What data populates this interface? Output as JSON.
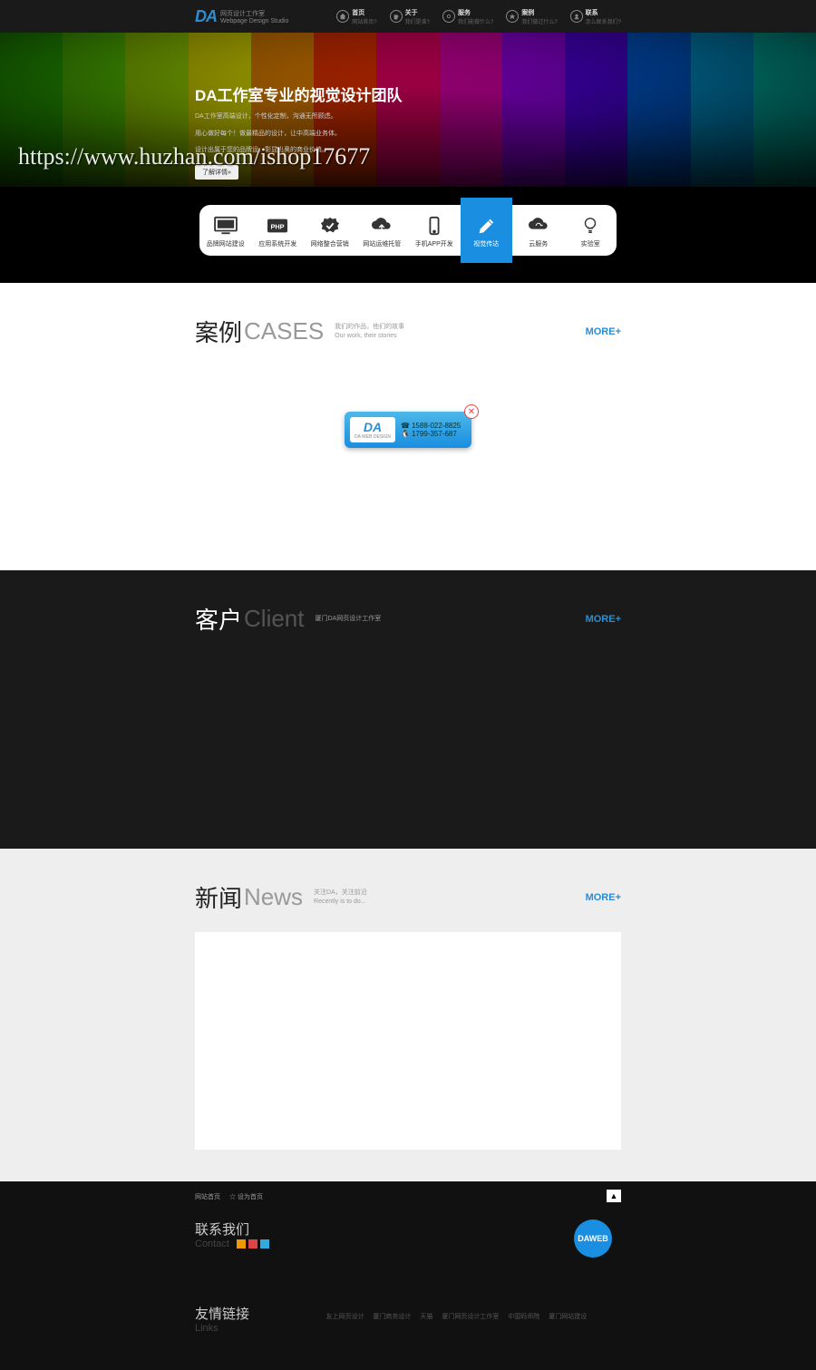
{
  "logo": {
    "mark": "DA",
    "text": "网页设计工作室",
    "text_en": "Webpage Design Studio"
  },
  "nav": [
    {
      "title": "首页",
      "sub": "网站首页?"
    },
    {
      "title": "关于",
      "sub": "我们是谁?"
    },
    {
      "title": "服务",
      "sub": "我们能做什么?"
    },
    {
      "title": "案例",
      "sub": "我们做过什么?"
    },
    {
      "title": "联系",
      "sub": "怎么联系我们?"
    }
  ],
  "hero": {
    "title": "DA工作室专业的视觉设计团队",
    "desc1": "DA工作室高端设计，个性化定制，沟通无所顾虑。",
    "desc2": "用心做好每个！做最精品的设计，让中高端业务体。",
    "desc3": "设计出属于您的品牌设，彰显出奥的商业价值。",
    "btn": "了解详情»"
  },
  "watermark": "https://www.huzhan.com/ishop17677",
  "services": [
    {
      "label": "品牌网站建设"
    },
    {
      "label": "应用系统开发"
    },
    {
      "label": "网络整合营销"
    },
    {
      "label": "网站运维托管"
    },
    {
      "label": "手机APP开发"
    },
    {
      "label": "视觉传达"
    },
    {
      "label": "云服务"
    },
    {
      "label": "实验室"
    }
  ],
  "sections": {
    "cases": {
      "cn": "案例",
      "en": "CASES",
      "sub1": "我们的作品，他们的故事",
      "sub2": "Our work, their stories",
      "more": "MORE+"
    },
    "client": {
      "cn": "客户",
      "en": "Client",
      "sub1": "厦门DA网页设计工作室",
      "more": "MORE+"
    },
    "news": {
      "cn": "新闻",
      "en": "News",
      "sub1": "关注DA，关注前沿",
      "sub2": "Recently is to do...",
      "more": "MORE+"
    }
  },
  "popup": {
    "logo": "DA",
    "logo_sub": "DA WEB DESIGN",
    "phone": "1588-022-8825",
    "qq": "1799-357-687",
    "close": "✕"
  },
  "footer": {
    "link1": "网站首页",
    "link2": "☆ 设为首页",
    "scroll": "▲",
    "contact_cn": "联系我们",
    "contact_en": "Contact",
    "daweb": "DAWEB",
    "friend_cn": "友情链接",
    "friend_en": "Links",
    "friendlinks": [
      "友上网页设计",
      "厦门商务设计",
      "天猫",
      "厦门网页设计工作室",
      "中国码师院",
      "厦门网站建设"
    ]
  }
}
